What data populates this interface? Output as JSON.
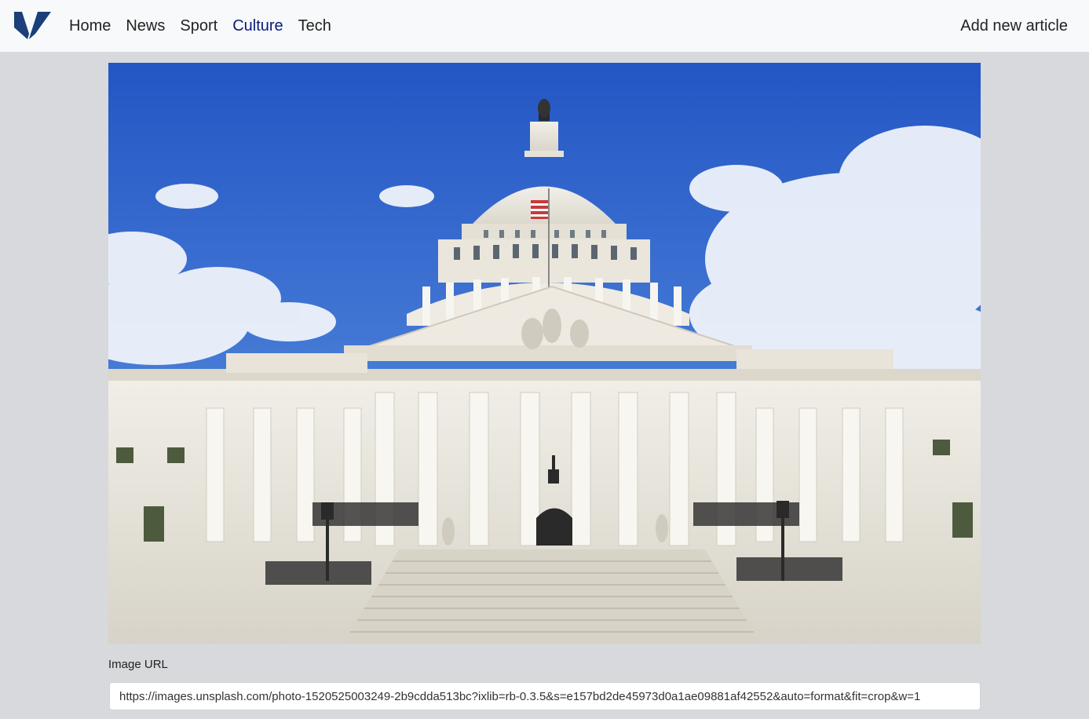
{
  "nav": {
    "logo_icon": "v-logo-icon",
    "links": [
      {
        "label": "Home"
      },
      {
        "label": "News"
      },
      {
        "label": "Sport"
      },
      {
        "label": "Culture",
        "active": true
      },
      {
        "label": "Tech"
      }
    ],
    "add_article": "Add new article",
    "active_color": "#0a1a78",
    "logo_color": "#1a3f7a"
  },
  "hero": {
    "alt_subject": "capitol-building-photo"
  },
  "form": {
    "image_url_label": "Image URL",
    "image_url_value": "https://images.unsplash.com/photo-1520525003249-2b9cdda513bc?ixlib=rb-0.3.5&s=e157bd2de45973d0a1ae09881af42552&auto=format&fit=crop&w=1"
  }
}
